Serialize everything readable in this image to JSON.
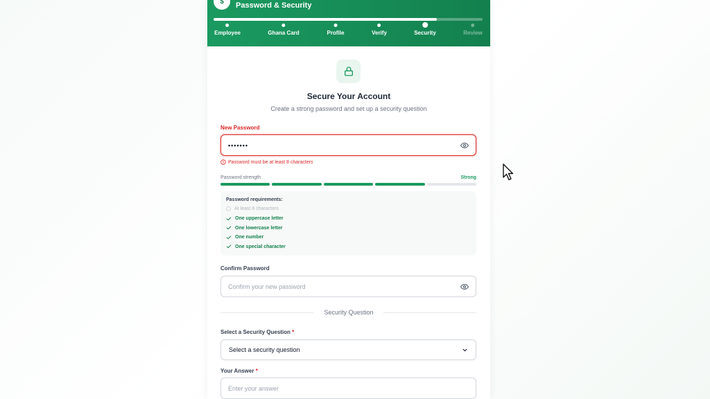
{
  "header": {
    "step_icon": "$",
    "title": "Password & Security",
    "progress": 0.83,
    "steps": [
      {
        "label": "Employee",
        "state": "done"
      },
      {
        "label": "Ghana Card",
        "state": "done"
      },
      {
        "label": "Profile",
        "state": "done"
      },
      {
        "label": "Verify",
        "state": "done"
      },
      {
        "label": "Security",
        "state": "current"
      },
      {
        "label": "Review",
        "state": "pending"
      }
    ]
  },
  "main": {
    "icon": "lock-icon",
    "title": "Secure Your Account",
    "subtitle": "Create a strong password and set up a security question"
  },
  "new_password": {
    "label": "New Password",
    "value": "•••••••",
    "error": "Password must be at least 8 characters"
  },
  "strength": {
    "label": "Password strength",
    "value": "Strong",
    "filled_segments": 4,
    "total_segments": 5,
    "color": "#1a9a60"
  },
  "requirements": {
    "title": "Password requirements:",
    "items": [
      {
        "text": "At least 8 characters",
        "met": false
      },
      {
        "text": "One uppercase letter",
        "met": true
      },
      {
        "text": "One lowercase letter",
        "met": true
      },
      {
        "text": "One number",
        "met": true
      },
      {
        "text": "One special character",
        "met": true
      }
    ]
  },
  "confirm_password": {
    "label": "Confirm Password",
    "placeholder": "Confirm your new password"
  },
  "security_section": {
    "title": "Security Question",
    "question_label": "Select a Security Question",
    "question_required": "*",
    "question_selected": "Select a security question",
    "answer_label": "Your Answer",
    "answer_required": "*",
    "answer_placeholder": "Enter your answer"
  },
  "colors": {
    "brand": "#13804e",
    "error": "#dc2626"
  }
}
